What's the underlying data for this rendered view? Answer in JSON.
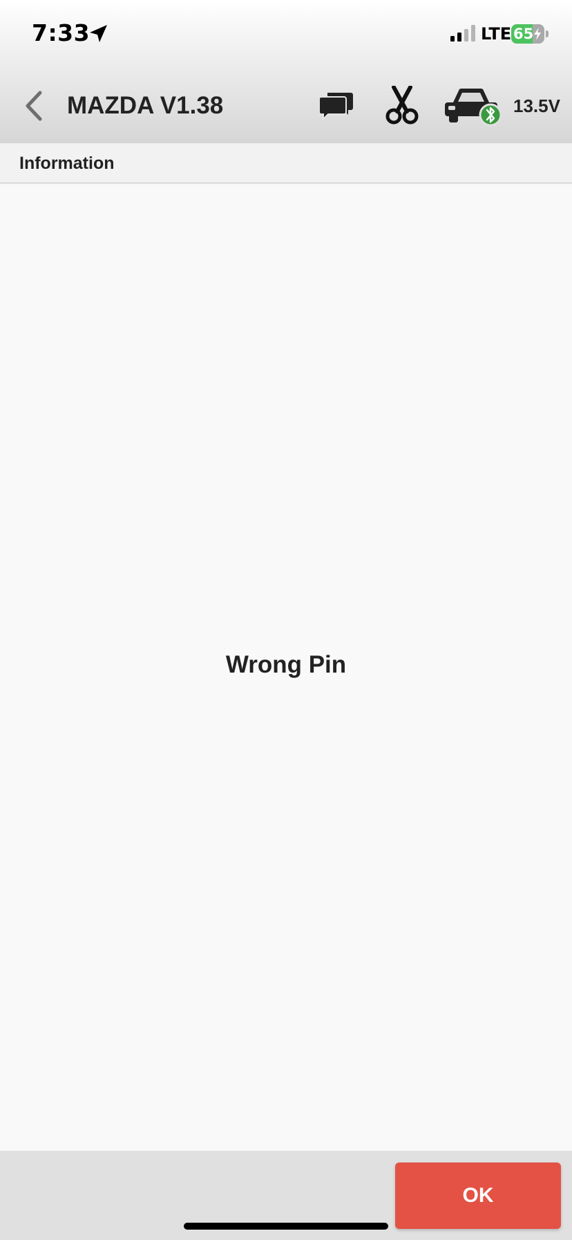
{
  "status_bar": {
    "time": "7:33",
    "network": "LTE",
    "battery_level": "65",
    "battery_fraction": 0.65,
    "icons": [
      "location-arrow-icon",
      "cellular-signal-icon",
      "battery-charging-icon"
    ]
  },
  "header": {
    "title": "MAZDA V1.38",
    "voltage": "13.5V",
    "icons": [
      "back-chevron-icon",
      "chat-bubbles-icon",
      "scissors-icon",
      "car-bluetooth-icon"
    ]
  },
  "section": {
    "title": "Information"
  },
  "content": {
    "message": "Wrong Pin"
  },
  "footer": {
    "ok_label": "OK"
  },
  "colors": {
    "accent_button": "#e35244",
    "battery_green": "#4cc35f",
    "bluetooth_badge": "#3a9a3f"
  }
}
